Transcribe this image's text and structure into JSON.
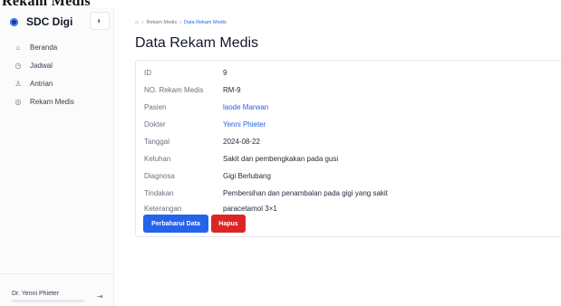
{
  "header": {
    "title": "Rekam Medis"
  },
  "sidebar": {
    "brand": "SDC Digi",
    "theme_icon": "◐",
    "items": [
      {
        "label": "Beranda",
        "icon": "home-icon",
        "glyph": "⌂"
      },
      {
        "label": "Jadwal",
        "icon": "clock-icon",
        "glyph": "◷"
      },
      {
        "label": "Antrian",
        "icon": "person-icon",
        "glyph": "♙"
      },
      {
        "label": "Rekam Medis",
        "icon": "record-icon",
        "glyph": "◎"
      }
    ],
    "user": {
      "name": "Dr. Yenni Phieter",
      "logout_glyph": "⇥"
    }
  },
  "breadcrumb": {
    "home_glyph": "⌂",
    "items": [
      "Rekam Medis",
      "Data Rekam Medis"
    ]
  },
  "page": {
    "title": "Data Rekam Medis"
  },
  "record": {
    "fields": [
      {
        "label": "ID",
        "value": "9"
      },
      {
        "label": "NO. Rekam Medis",
        "value": "RM-9"
      },
      {
        "label": "Pasien",
        "value": "laode Marwan"
      },
      {
        "label": "Dokter",
        "value": "Yenni Phieter"
      },
      {
        "label": "Tanggal",
        "value": "2024-08-22"
      },
      {
        "label": "Keluhan",
        "value": "Sakit dan pembengkakan pada gusi"
      },
      {
        "label": "Diagnosa",
        "value": "Gigi Berlubang"
      },
      {
        "label": "Tindakan",
        "value": "Pembersihan dan penambalan pada gigi yang sakit"
      },
      {
        "label": "Keterangan",
        "value": "paracetamol 3×1"
      }
    ]
  },
  "actions": {
    "update_label": "Perbaharui Data",
    "delete_label": "Hapus"
  },
  "colors": {
    "primary": "#2563eb",
    "danger": "#dc2626",
    "link": "#2563eb"
  }
}
